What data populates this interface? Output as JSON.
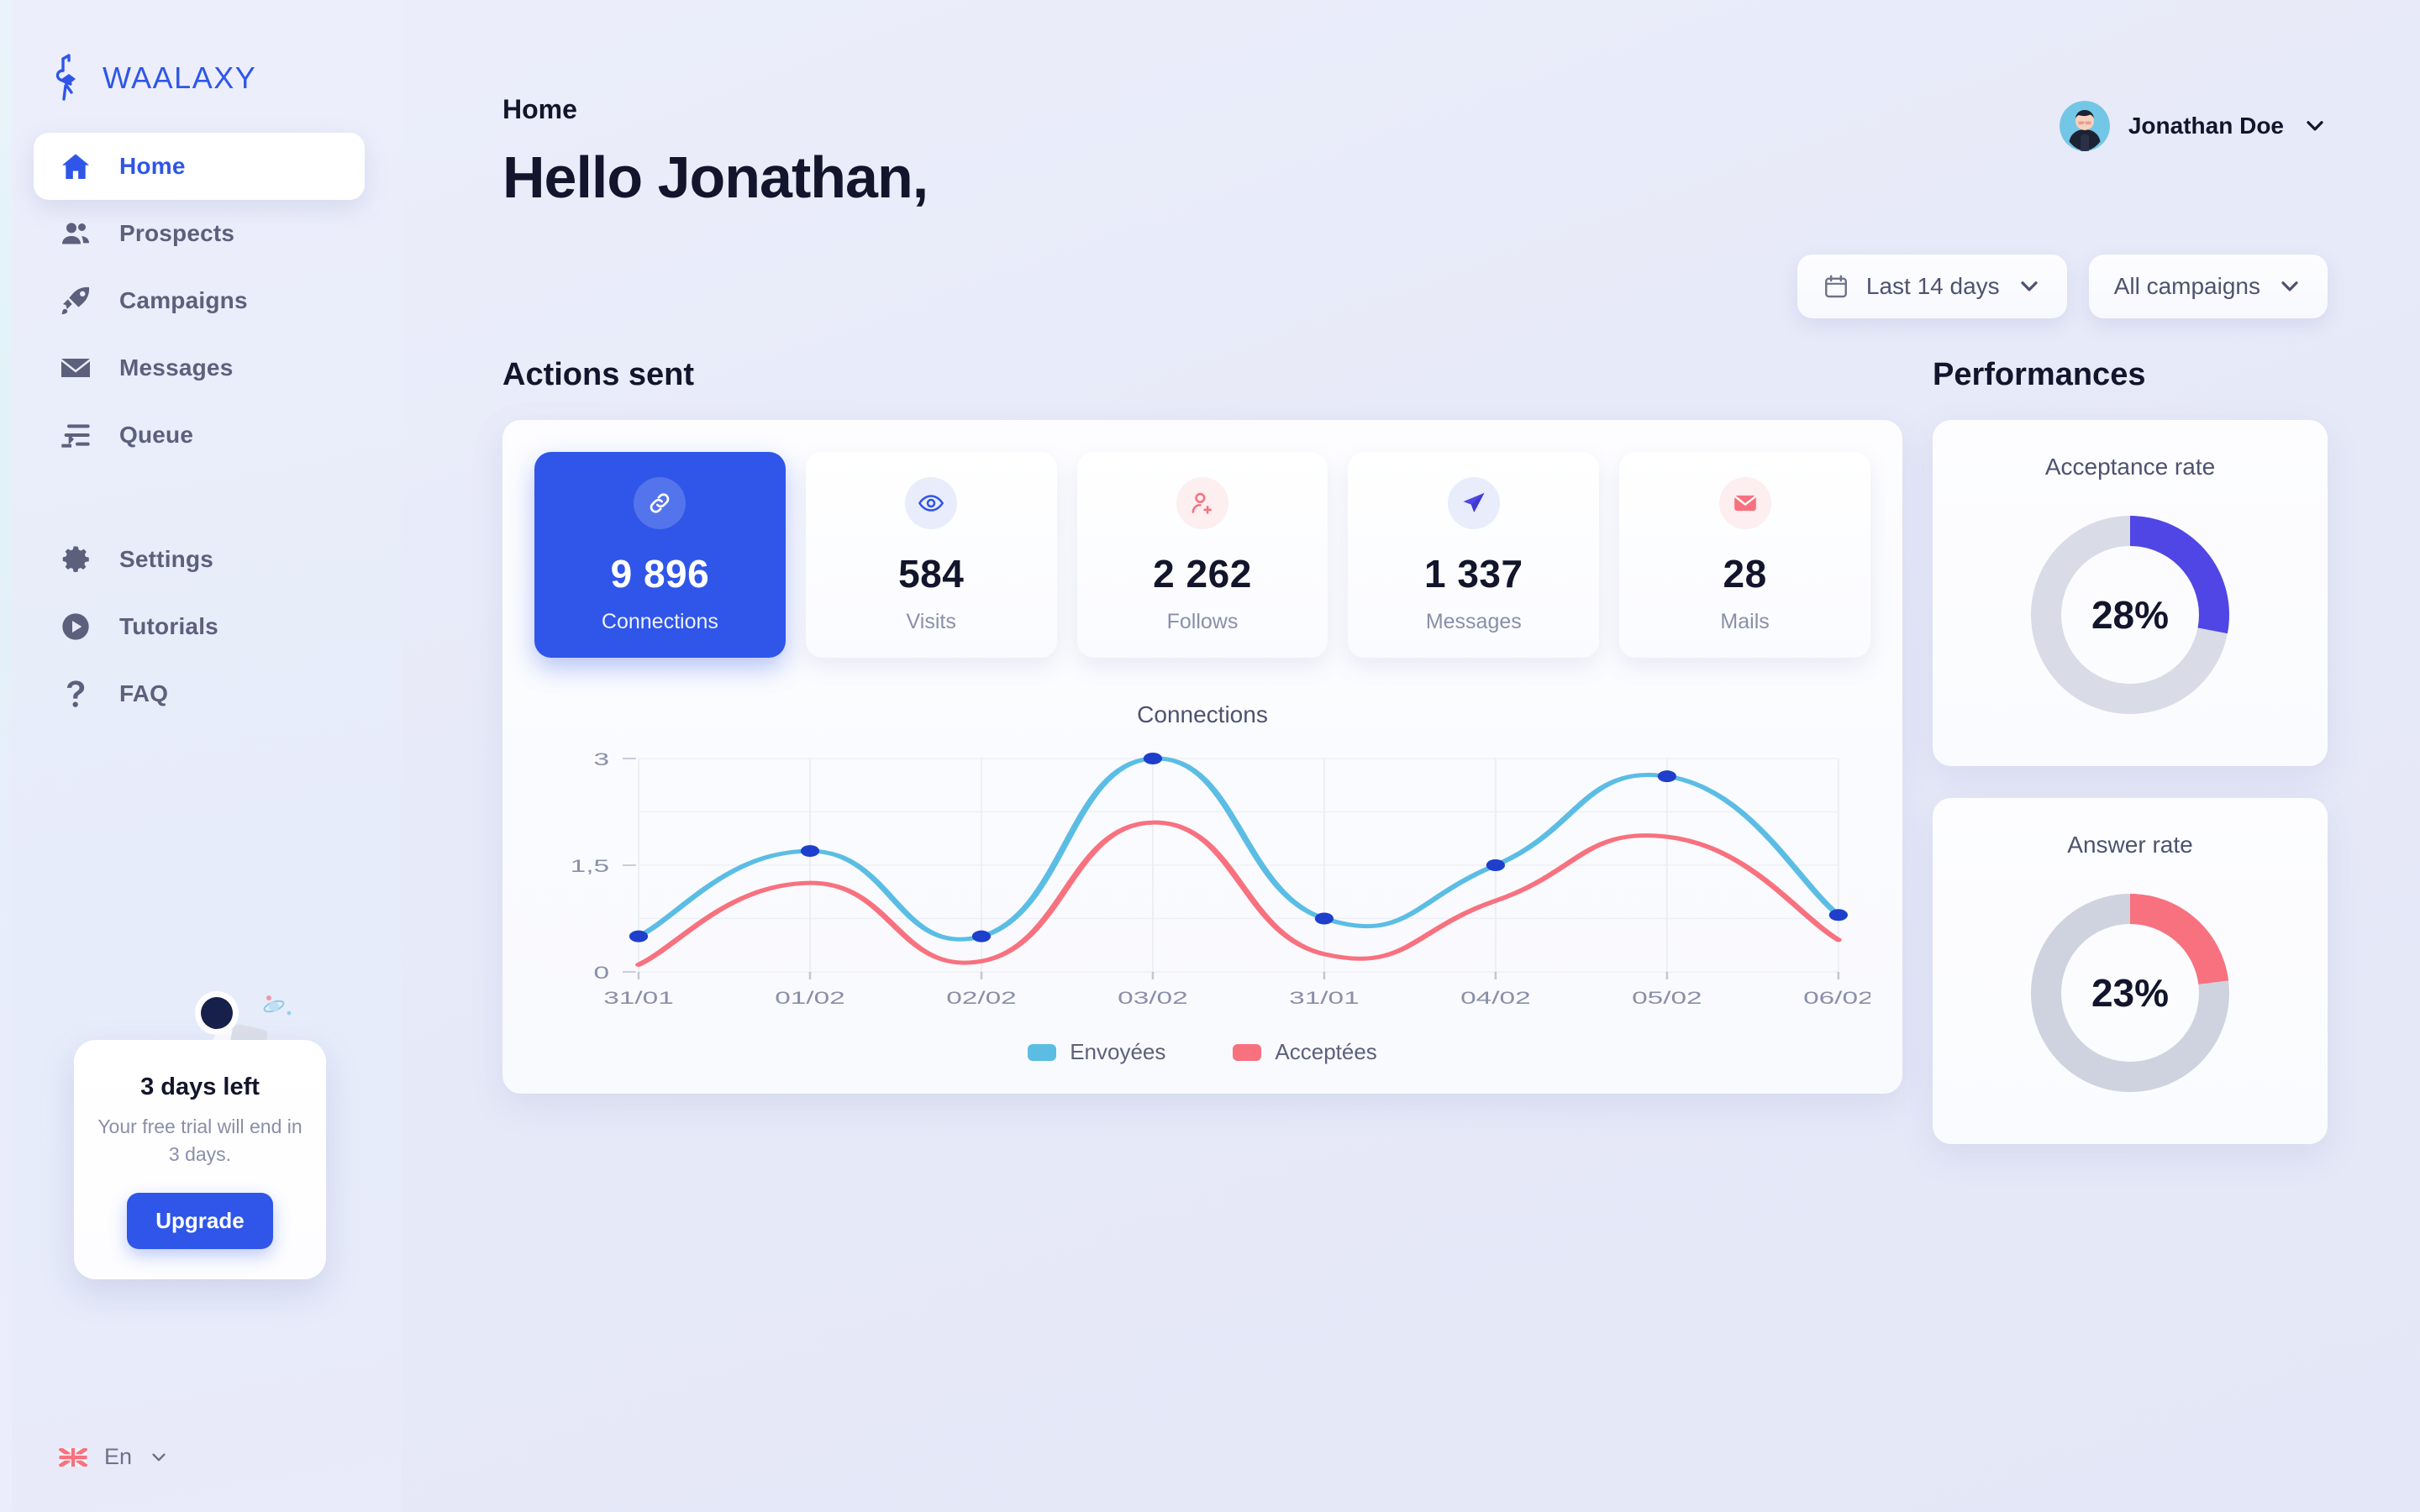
{
  "brand": {
    "name": "WAALAXY",
    "accent": "#2F56E8",
    "logo_icon": "flamingo-logo-icon"
  },
  "sidebar": {
    "items": [
      {
        "label": "Home",
        "icon": "home-icon",
        "active": true
      },
      {
        "label": "Prospects",
        "icon": "people-icon",
        "active": false
      },
      {
        "label": "Campaigns",
        "icon": "rocket-icon",
        "active": false
      },
      {
        "label": "Messages",
        "icon": "envelope-icon",
        "active": false
      },
      {
        "label": "Queue",
        "icon": "queue-icon",
        "active": false
      }
    ],
    "secondary_items": [
      {
        "label": "Settings",
        "icon": "gear-icon"
      },
      {
        "label": "Tutorials",
        "icon": "play-circle-icon"
      },
      {
        "label": "FAQ",
        "icon": "question-mark-icon"
      }
    ],
    "trial": {
      "title": "3 days left",
      "subtitle": "Your free trial will end in 3 days.",
      "button": "Upgrade",
      "illustration": "astronaut-illustration"
    },
    "language": {
      "code": "En",
      "flag": "uk-flag-icon",
      "chevron": "chevron-down-icon"
    }
  },
  "header": {
    "breadcrumb": "Home",
    "greeting": "Hello Jonathan,",
    "user": {
      "name": "Jonathan Doe",
      "avatar": "user-avatar",
      "chevron": "chevron-down-icon"
    }
  },
  "filters": {
    "date_range": {
      "value": "Last 14 days",
      "icon": "calendar-icon",
      "chevron": "chevron-down-icon"
    },
    "campaign": {
      "value": "All campaigns",
      "chevron": "chevron-down-icon"
    }
  },
  "actions_sent": {
    "title": "Actions sent",
    "stats": [
      {
        "value": "9 896",
        "label": "Connections",
        "icon": "link-icon",
        "active": true,
        "icon_color": "#FFFFFF",
        "bubble": "white"
      },
      {
        "value": "584",
        "label": "Visits",
        "icon": "eye-icon",
        "active": false,
        "icon_color": "#2F56E8",
        "bubble": "lav"
      },
      {
        "value": "2 262",
        "label": "Follows",
        "icon": "user-plus-icon",
        "active": false,
        "icon_color": "#F8717F",
        "bubble": "pink"
      },
      {
        "value": "1 337",
        "label": "Messages",
        "icon": "send-icon",
        "active": false,
        "icon_color": "#4F46E5",
        "bubble": "lav"
      },
      {
        "value": "28",
        "label": "Mails",
        "icon": "mail-icon",
        "active": false,
        "icon_color": "#F8717F",
        "bubble": "pink"
      }
    ]
  },
  "chart_data": {
    "type": "line",
    "title": "Connections",
    "xlabel": "",
    "ylabel": "",
    "ylim": [
      0,
      3
    ],
    "yticks": [
      0,
      1.5,
      3
    ],
    "ytick_labels": [
      "0",
      "1,5",
      "3"
    ],
    "grid": true,
    "legend_position": "bottom",
    "categories": [
      "31/01",
      "01/02",
      "02/02",
      "03/02",
      "31/01",
      "04/02",
      "05/02",
      "06/02"
    ],
    "series": [
      {
        "name": "Envoyées",
        "color": "#5BBDE4",
        "values": [
          0.5,
          1.7,
          0.5,
          3.0,
          0.75,
          1.5,
          2.75,
          0.8
        ]
      },
      {
        "name": "Acceptées",
        "color": "#F8717F",
        "values": [
          0.1,
          1.25,
          0.15,
          2.1,
          0.25,
          1.0,
          1.9,
          0.45
        ]
      }
    ],
    "marker_series": "Envoyées",
    "marker_color": "#1E3FCB"
  },
  "performances": {
    "title": "Performances",
    "cards": [
      {
        "title": "Acceptance rate",
        "value": "28%",
        "percent": 28,
        "color": "#4F46E5",
        "track": "#D9DCE7"
      },
      {
        "title": "Answer rate",
        "value": "23%",
        "percent": 23,
        "color": "#F8717F",
        "track": "#CFD3DF"
      }
    ]
  }
}
